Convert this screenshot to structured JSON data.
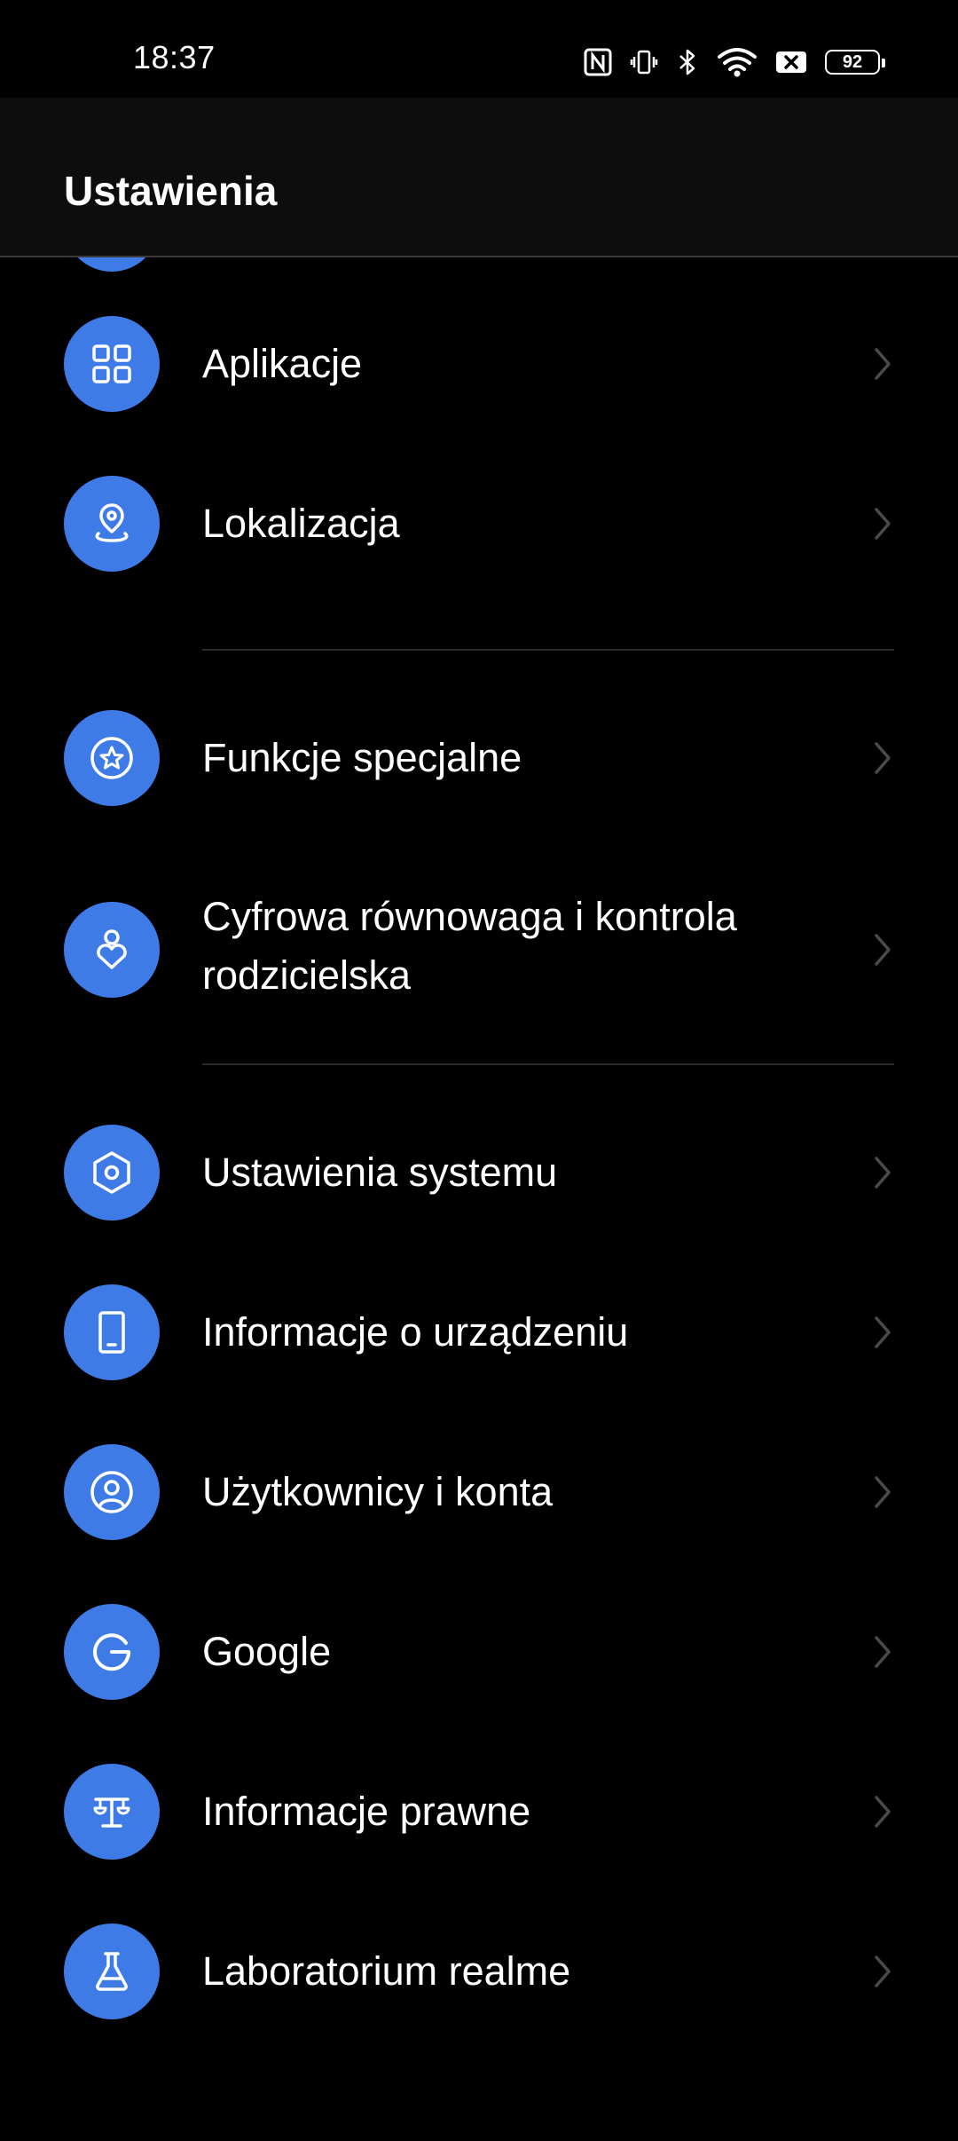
{
  "status_bar": {
    "time": "18:37",
    "battery_level": "92",
    "icons": [
      "nfc-icon",
      "vibrate-icon",
      "bluetooth-icon",
      "wifi-icon",
      "sim-off-icon",
      "battery-icon"
    ]
  },
  "app_bar": {
    "title": "Ustawienia"
  },
  "colors": {
    "accent": "#3f7be6",
    "background": "#000000",
    "app_bar": "#0d0d0d",
    "divider": "#2a2a2a",
    "chevron": "#4a4a4a"
  },
  "items": [
    {
      "label": "Aplikacje",
      "icon": "apps-grid-icon"
    },
    {
      "label": "Lokalizacja",
      "icon": "location-pin-icon"
    },
    {
      "label": "Funkcje specjalne",
      "icon": "star-circle-icon"
    },
    {
      "label": "Cyfrowa równowaga i kontrola rodzicielska",
      "icon": "digital-wellbeing-icon"
    },
    {
      "label": "Ustawienia systemu",
      "icon": "hexagon-settings-icon"
    },
    {
      "label": "Informacje o urządzeniu",
      "icon": "phone-device-icon"
    },
    {
      "label": "Użytkownicy i konta",
      "icon": "user-account-icon"
    },
    {
      "label": "Google",
      "icon": "google-g-icon"
    },
    {
      "label": "Informacje prawne",
      "icon": "legal-scales-icon"
    },
    {
      "label": "Laboratorium realme",
      "icon": "lab-flask-icon"
    }
  ]
}
